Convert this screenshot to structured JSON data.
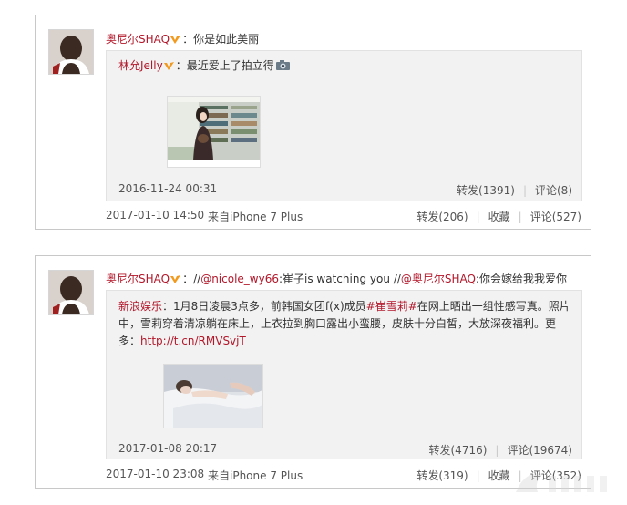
{
  "posts": [
    {
      "author": "奥尼尔SHAQ",
      "colon": "：",
      "text": "你是如此美丽",
      "repost": {
        "author": "林允Jelly",
        "colon": "：",
        "text": "最近爱上了拍立得",
        "date": "2016-11-24 00:31",
        "forward": "转发(1391)",
        "comment": "评论(8)"
      },
      "date": "2017-01-10 14:50",
      "source": "来自iPhone 7 Plus",
      "forward": "转发(206)",
      "favorite": "收藏",
      "comment": "评论(527)"
    },
    {
      "author": "奥尼尔SHAQ",
      "colon": "：",
      "text_prefix": "//",
      "mention1": "@nicole_wy66",
      "text_mid": ":崔子is watching you //",
      "mention2": "@奥尼尔SHAQ",
      "text_end": ":你会嫁给我我爱你",
      "repost": {
        "author": "新浪娱乐",
        "colon": "：",
        "text_a": "1月8日凌晨3点多，前韩国女团f(x)成员",
        "hashtag": "#崔雪莉#",
        "text_b": "在网上晒出一组性感写真。照片中，雪莉穿着清凉躺在床上，上衣拉到胸口露出小蛮腰，皮肤十分白皙，大放深夜福利。更多：",
        "link": "http://t.cn/RMVSvjT",
        "date": "2017-01-08 20:17",
        "forward": "转发(4716)",
        "comment": "评论(19674)"
      },
      "date": "2017-01-10 23:08",
      "source": "来自iPhone 7 Plus",
      "forward": "转发(319)",
      "favorite": "收藏",
      "comment": "评论(352)"
    }
  ],
  "separator": "|"
}
